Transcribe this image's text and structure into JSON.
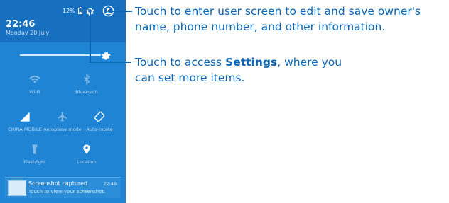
{
  "status_bar": {
    "battery": "12%"
  },
  "header": {
    "time": "22:46",
    "date": "Monday 20 July"
  },
  "tiles": [
    {
      "label": "Wi-Fi",
      "icon": "wifi-icon"
    },
    {
      "label": "Bluetooth",
      "icon": "bluetooth-icon"
    },
    {
      "label": "CHINA MOBILE",
      "icon": "signal-icon"
    },
    {
      "label": "Aeroplane mode",
      "icon": "airplane-icon"
    },
    {
      "label": "Auto-rotate",
      "icon": "rotate-icon"
    },
    {
      "label": "Flashlight",
      "icon": "flashlight-icon"
    },
    {
      "label": "Location",
      "icon": "location-icon"
    }
  ],
  "notification": {
    "title": "Screenshot captured",
    "text": "Touch to view your screenshot.",
    "time": "22:46"
  },
  "callouts": {
    "user_line1": "Touch to enter user screen to edit and save owner's",
    "user_line2": "name, phone number, and other information.",
    "settings_pre": "Touch to access ",
    "settings_bold": "Settings",
    "settings_post": ", where you",
    "settings_line2": "can set more items."
  },
  "colors": {
    "panel": "#1f84d3",
    "header": "#1670bf",
    "callout": "#0b66b3"
  }
}
